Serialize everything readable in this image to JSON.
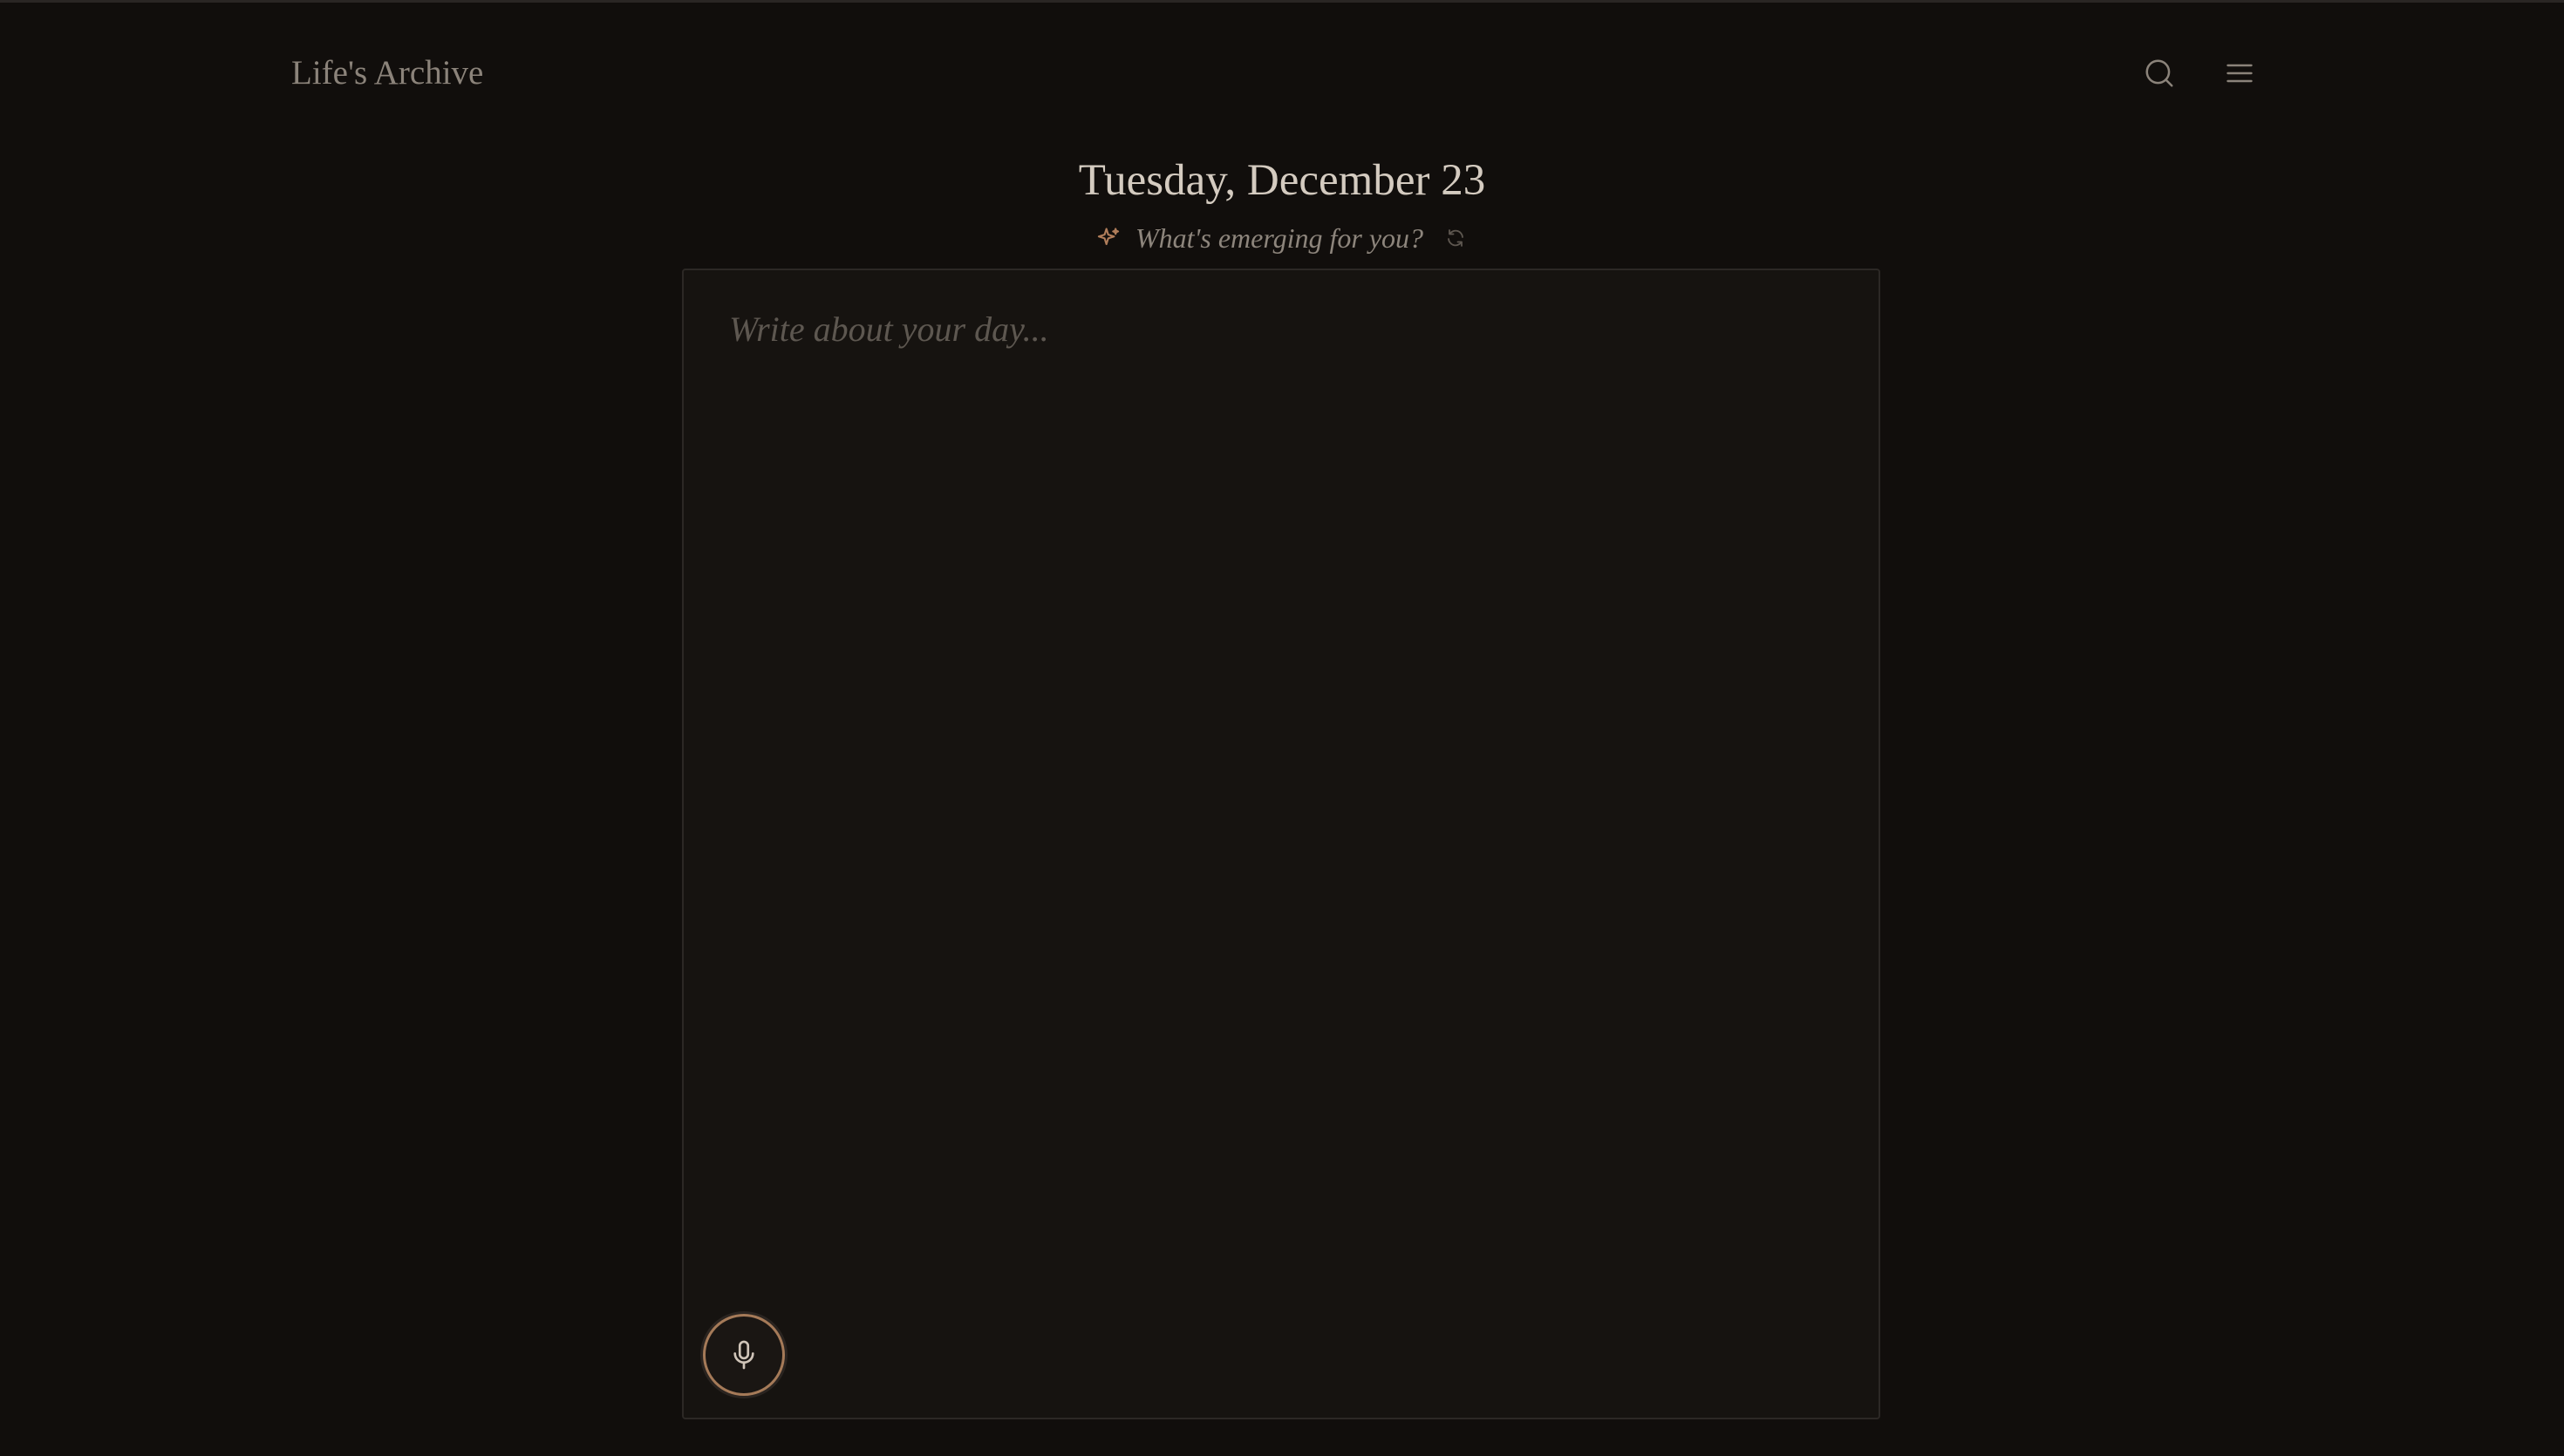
{
  "header": {
    "title": "Life's Archive",
    "search_icon": "search-icon",
    "menu_icon": "menu-icon"
  },
  "journal": {
    "date": "Tuesday, December 23",
    "prompt": "What's emerging for you?",
    "prompt_icon": "sparkle-icon",
    "refresh_icon": "refresh-icon",
    "placeholder": "Write about your day...",
    "mic_icon": "microphone-icon"
  },
  "colors": {
    "background": "#110e0c",
    "editor_background": "#161310",
    "accent": "#a57a58",
    "text_primary": "#d4cbc0",
    "text_muted": "#8b837a"
  }
}
